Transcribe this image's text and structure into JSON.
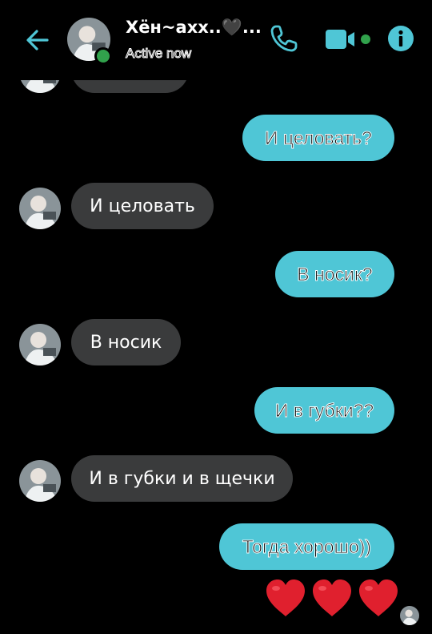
{
  "header": {
    "contact_name": "Хён~ахх..🖤...",
    "status": "Active now",
    "icons": [
      "back-arrow-icon",
      "phone-icon",
      "video-camera-icon",
      "info-icon"
    ],
    "accent_color": "#4fc6d6"
  },
  "messages": [
    {
      "side": "in",
      "text": ""
    },
    {
      "side": "out",
      "text": "И целовать?"
    },
    {
      "side": "in",
      "text": "И целовать"
    },
    {
      "side": "out",
      "text": "В носик?"
    },
    {
      "side": "in",
      "text": "В носик"
    },
    {
      "side": "out",
      "text": "И в губки??"
    },
    {
      "side": "in",
      "text": "И в губки и в щечки"
    },
    {
      "side": "out",
      "text": "Тогда хорошо))"
    },
    {
      "side": "out",
      "text": "❤❤❤"
    }
  ],
  "colors": {
    "incoming_bubble": "#3a3b3c",
    "outgoing_bubble": "#4fc6d6",
    "online": "#31a24c",
    "hearts": "#e0202e"
  }
}
